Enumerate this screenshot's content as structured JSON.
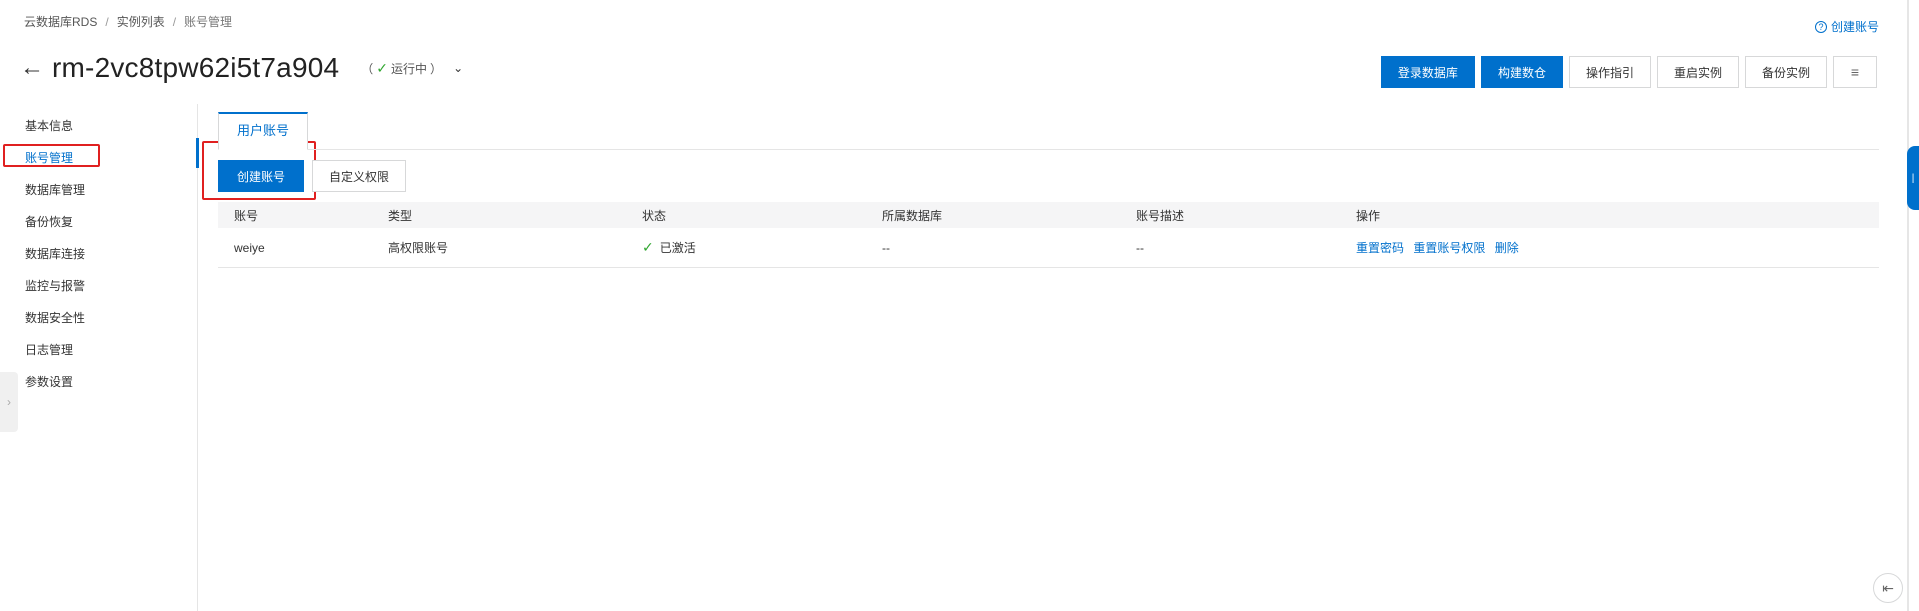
{
  "breadcrumb": [
    "云数据库RDS",
    "实例列表",
    "账号管理"
  ],
  "help_link": "创建账号",
  "header": {
    "back_arrow": "←",
    "instance_id": "rm-2vc8tpw62i5t7a904",
    "status_check": "✓",
    "status": "运行中",
    "status_open": "（",
    "status_close": "）",
    "status_chevron": "⌄"
  },
  "actions": [
    {
      "label": "登录数据库",
      "primary": true
    },
    {
      "label": "构建数仓",
      "primary": true
    },
    {
      "label": "操作指引",
      "primary": false
    },
    {
      "label": "重启实例",
      "primary": false
    },
    {
      "label": "备份实例",
      "primary": false
    },
    {
      "label": "≡",
      "icon": "list-icon"
    }
  ],
  "sidebar": {
    "items": [
      {
        "label": "基本信息"
      },
      {
        "label": "账号管理",
        "active": true
      },
      {
        "label": "数据库管理"
      },
      {
        "label": "备份恢复"
      },
      {
        "label": "数据库连接"
      },
      {
        "label": "监控与报警"
      },
      {
        "label": "数据安全性"
      },
      {
        "label": "日志管理"
      },
      {
        "label": "参数设置"
      }
    ]
  },
  "tabs": [
    {
      "label": "用户账号",
      "active": true
    }
  ],
  "toolbar": {
    "create_label": "创建账号",
    "custom_label": "自定义权限"
  },
  "table": {
    "columns": [
      "账号",
      "类型",
      "状态",
      "所属数据库",
      "账号描述",
      "操作"
    ],
    "rows": [
      {
        "account": "weiye",
        "type": "高权限账号",
        "status_icon": "✓",
        "status": "已激活",
        "database": "--",
        "description": "--",
        "ops": [
          "重置密码",
          "重置账号权限",
          "删除"
        ]
      }
    ]
  },
  "colors": {
    "primary": "#0070cc",
    "success": "#2fa62f",
    "highlight": "#e02020"
  }
}
